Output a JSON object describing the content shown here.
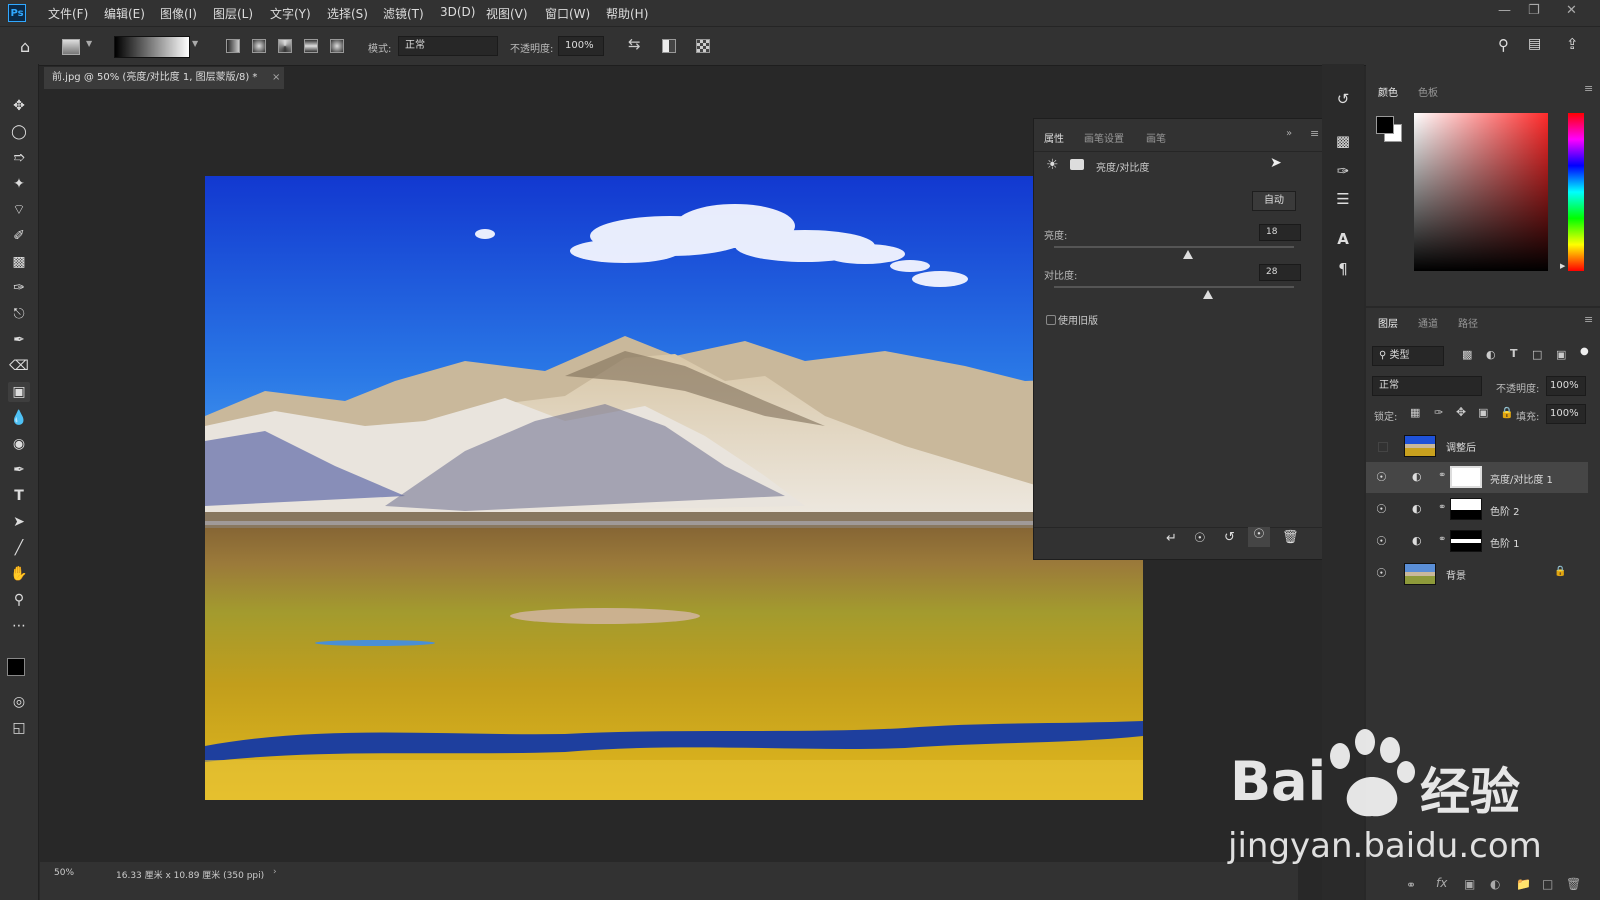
{
  "app": {
    "logo": "Ps",
    "menu": [
      "文件(F)",
      "编辑(E)",
      "图像(I)",
      "图层(L)",
      "文字(Y)",
      "选择(S)",
      "滤镜(T)",
      "3D(D)",
      "视图(V)",
      "窗口(W)",
      "帮助(H)"
    ]
  },
  "options_bar": {
    "mode_label": "模式:",
    "mode_value": "正常",
    "opacity_label": "不透明度:",
    "opacity_value": "100%"
  },
  "document": {
    "tab_title": "前.jpg @ 50% (亮度/对比度 1, 图层蒙版/8) *",
    "zoom": "50%",
    "doc_info": "16.33 厘米 x 10.89 厘米 (350 ppi)"
  },
  "properties": {
    "tabs": [
      "属性",
      "画笔设置",
      "画笔"
    ],
    "title": "亮度/对比度",
    "auto_button": "自动",
    "brightness_label": "亮度:",
    "brightness_value": "18",
    "brightness_level": 0.56,
    "contrast_label": "对比度:",
    "contrast_value": "28",
    "contrast_level": 0.64,
    "legacy_label": "使用旧版",
    "legacy_checked": false
  },
  "color_panel": {
    "tabs": [
      "颜色",
      "色板"
    ],
    "hue_color": "#ff2a2a"
  },
  "layers_panel": {
    "tabs": [
      "图层",
      "通道",
      "路径"
    ],
    "filter_label": "类型",
    "blend_mode": "正常",
    "opacity_label": "不透明度:",
    "opacity_value": "100%",
    "lock_label": "锁定:",
    "fill_label": "填充:",
    "fill_value": "100%",
    "layers": [
      {
        "name": "调整后",
        "visible": false,
        "type": "image"
      },
      {
        "name": "亮度/对比度 1",
        "visible": true,
        "type": "adjustment",
        "selected": true
      },
      {
        "name": "色阶 2",
        "visible": true,
        "type": "adjustment"
      },
      {
        "name": "色阶 1",
        "visible": true,
        "type": "adjustment"
      },
      {
        "name": "背景",
        "visible": true,
        "type": "image",
        "locked": true
      }
    ]
  },
  "watermark": {
    "brand_left": "Bai",
    "brand_right": "经验",
    "url": "jingyan.baidu.com"
  },
  "colors": {
    "ui_bg": "#323232",
    "canvas_bg": "#282828",
    "accent": "#31a8ff",
    "sky_top": "#1640d8",
    "sky_bottom": "#4aa3f2"
  }
}
